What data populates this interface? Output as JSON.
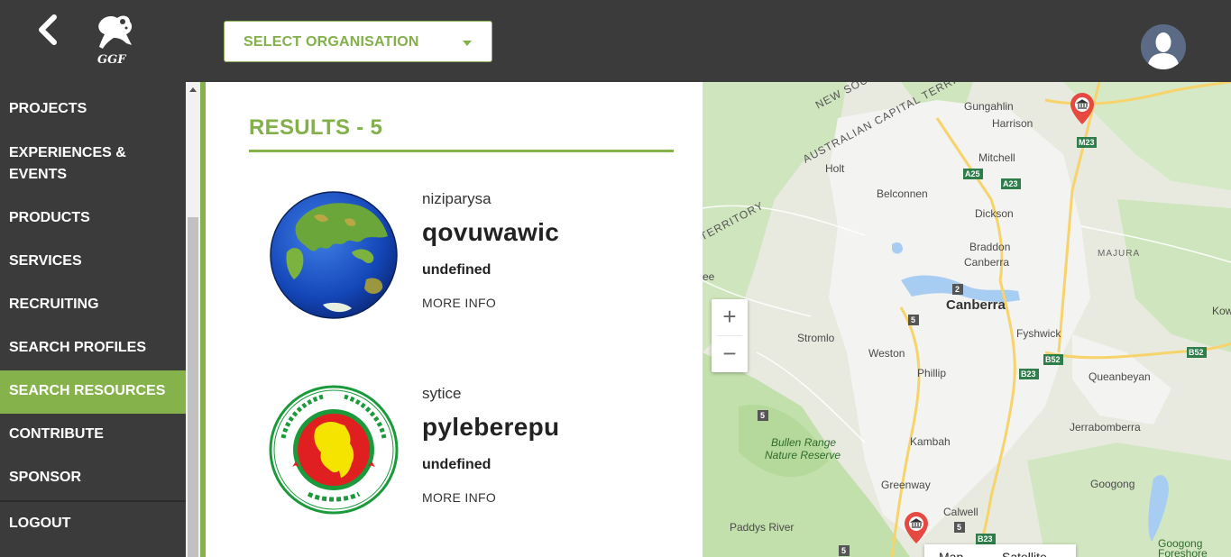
{
  "header": {
    "org_select_label": "SELECT ORGANISATION",
    "logo_text": "GGF"
  },
  "sidebar": {
    "items": [
      {
        "label": "PROJECTS",
        "active": false
      },
      {
        "label": "EXPERIENCES & EVENTS",
        "active": false
      },
      {
        "label": "PRODUCTS",
        "active": false
      },
      {
        "label": "SERVICES",
        "active": false
      },
      {
        "label": "RECRUITING",
        "active": false
      },
      {
        "label": "SEARCH PROFILES",
        "active": false
      },
      {
        "label": "SEARCH RESOURCES",
        "active": true
      },
      {
        "label": "CONTRIBUTE",
        "active": false
      },
      {
        "label": "SPONSOR",
        "active": false
      },
      {
        "label": "LOGOUT",
        "active": false
      }
    ]
  },
  "results": {
    "title": "RESULTS - 5",
    "cards": [
      {
        "user": "niziparysa",
        "name": "qovuwawic",
        "description": "undefined",
        "more_label": "MORE INFO",
        "image": "globe-image"
      },
      {
        "user": "sytice",
        "name": "pyleberepu",
        "description": "undefined",
        "more_label": "MORE INFO",
        "image": "bangladesh-government-seal"
      }
    ]
  },
  "map": {
    "zoom_in": "+",
    "zoom_out": "−",
    "maptype_map": "Map",
    "maptype_satellite": "Satellite",
    "labels": {
      "new_south_wales": "NEW SOUTH WALES",
      "act": "AUSTRALIAN CAPITAL TERRITORY",
      "territory": "TERRITORY",
      "gungahlin": "Gungahlin",
      "harrison": "Harrison",
      "mitchell": "Mitchell",
      "holt": "Holt",
      "belconnen": "Belconnen",
      "dickson": "Dickson",
      "braddon": "Braddon",
      "canberra_small": "Canberra",
      "canberra": "Canberra",
      "majura": "MAJURA",
      "kow": "Kow",
      "stromlo": "Stromlo",
      "weston": "Weston",
      "fyshwick": "Fyshwick",
      "phillip": "Phillip",
      "queanbeyan": "Queanbeyan",
      "jerrabomberra": "Jerrabomberra",
      "bullen_range": "Bullen Range",
      "nature_reserve": "Nature Reserve",
      "kambah": "Kambah",
      "greenway": "Greenway",
      "googong": "Googong",
      "calwell": "Calwell",
      "paddys_river": "Paddys River",
      "googong_foreshore_1": "Googong",
      "googong_foreshore_2": "Foreshore",
      "ee": "ee"
    },
    "shields": {
      "a25": "A25",
      "a23": "A23",
      "m23": "M23",
      "b52a": "B52",
      "b52b": "B52",
      "b23a": "B23",
      "b23b": "B23",
      "r2": "2",
      "r5a": "5",
      "r5b": "5",
      "r5c": "5",
      "r5d": "5"
    },
    "colors": {
      "land": "#e8eadf",
      "park": "#c4e3b0",
      "water": "#a8cdf2",
      "urban": "#f1f1f1",
      "road_major": "#f7d36b",
      "pin": "#e5493f"
    }
  }
}
